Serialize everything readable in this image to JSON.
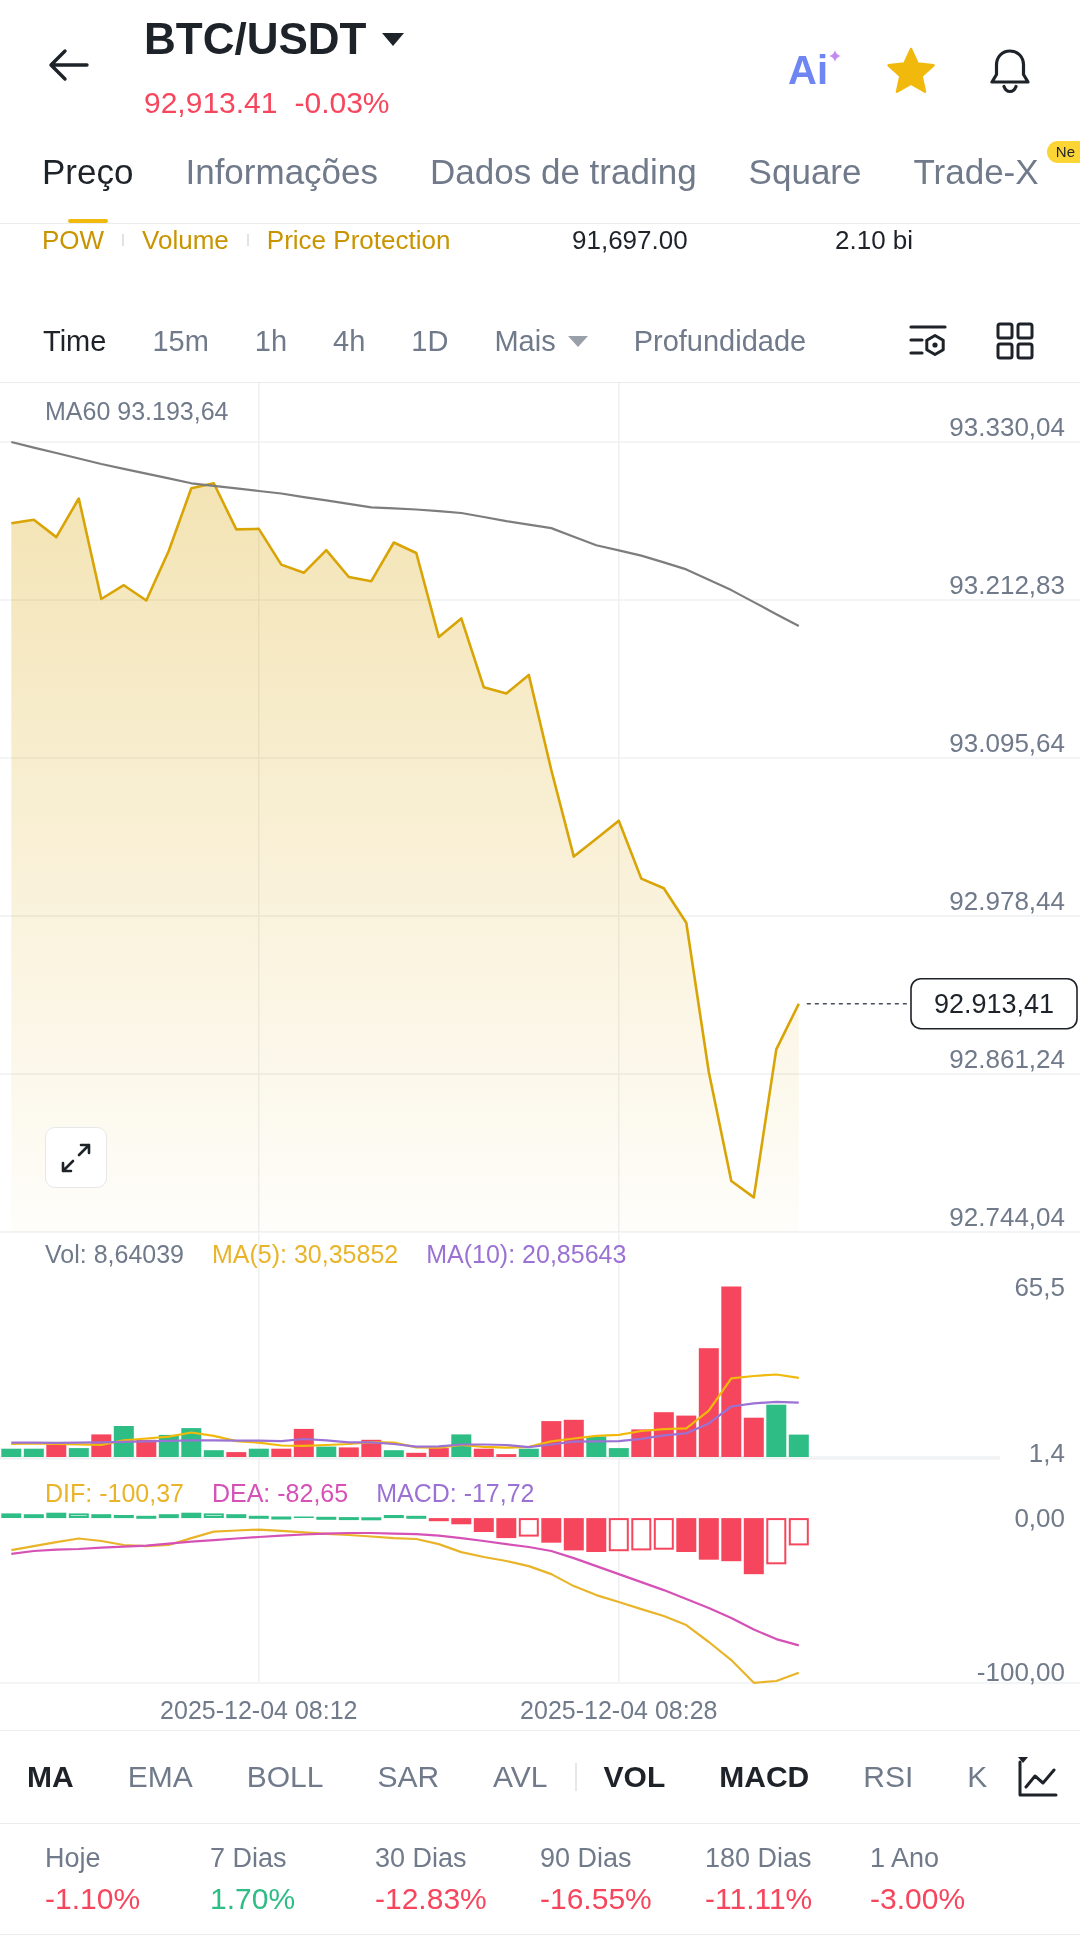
{
  "header": {
    "title": "BTC/USDT",
    "price": "92,913.41",
    "change": "-0.03%",
    "rising": false,
    "ai_label": "Ai",
    "favorite": true
  },
  "tabs": [
    {
      "label": "Preço",
      "selected": true
    },
    {
      "label": "Informações",
      "selected": false
    },
    {
      "label": "Dados de trading",
      "selected": false
    },
    {
      "label": "Square",
      "selected": false
    },
    {
      "label": "Trade-X",
      "selected": false,
      "badge": "Ne"
    }
  ],
  "info_row": {
    "tags": [
      "POW",
      "Volume",
      "Price Protection"
    ],
    "column_2": "91,697.00",
    "column_3": "2.10 bi"
  },
  "intervals": [
    {
      "label": "Time",
      "kind": "option",
      "selected": true
    },
    {
      "label": "15m",
      "kind": "option",
      "selected": false
    },
    {
      "label": "1h",
      "kind": "option",
      "selected": false
    },
    {
      "label": "4h",
      "kind": "option",
      "selected": false
    },
    {
      "label": "1D",
      "kind": "option",
      "selected": false
    },
    {
      "label": "Mais",
      "kind": "dropdown",
      "selected": false
    },
    {
      "label": "Profundidade",
      "kind": "option",
      "selected": false
    }
  ],
  "price_chart": {
    "legend": "MA60 93.193,64",
    "current_price": "92.913,41",
    "chart_data": {
      "type": "area",
      "categories": [
        null,
        null,
        null,
        null,
        null,
        null,
        null,
        null,
        null,
        null,
        null,
        null,
        null,
        null,
        null,
        null,
        null,
        null,
        null,
        null,
        null,
        null,
        null,
        null,
        null,
        null,
        null,
        null,
        null,
        null,
        null,
        null,
        null,
        null,
        null,
        null,
        null,
        null,
        null,
        null,
        null,
        null,
        null,
        null,
        null,
        null,
        null,
        null
      ],
      "series": [
        {
          "type": "area",
          "color": "#d9a406",
          "values": [
            93269.7,
            93272.3,
            93259.5,
            93288.1,
            93213.6,
            93223.8,
            93212.5,
            93249.3,
            93295.8,
            93299.4,
            93265.2,
            93265.6,
            93239.1,
            93233.0,
            93249.8,
            93229.9,
            93226.8,
            93255.5,
            93247.7,
            93185.4,
            93199.2,
            93148.1,
            93143.5,
            93157.3,
            93086.7,
            93022.5,
            93035.8,
            93049.1,
            93006.2,
            92999.0,
            92973.5,
            92862.7,
            92781.9,
            92769.7,
            92879.5,
            92913.4,
            null,
            null,
            null,
            null,
            null,
            null,
            null,
            null,
            null,
            null,
            null,
            null
          ]
        },
        {
          "type": "line",
          "color": "#7d7d7d",
          "values": [
            93330.0,
            93325.9,
            93321.9,
            93317.8,
            93313.7,
            93310.1,
            93306.6,
            93303.0,
            93299.4,
            93297.5,
            93295.6,
            93293.7,
            93291.8,
            93289.2,
            93286.7,
            93284.1,
            93281.5,
            93280.8,
            93280.0,
            93278.7,
            93277.4,
            93274.4,
            93271.3,
            93268.8,
            93266.2,
            93259.8,
            93253.4,
            93249.6,
            93245.8,
            93240.7,
            93235.5,
            93227.9,
            93220.2,
            93211.3,
            93202.3,
            93193.6,
            null,
            null,
            null,
            null,
            null,
            null,
            null,
            null,
            null,
            null,
            null,
            null
          ]
        }
      ],
      "ylim": [
        92744.04,
        93373.8
      ],
      "yticks": [
        {
          "value": 93330.04,
          "label": "93.330,04"
        },
        {
          "value": 93212.83,
          "label": "93.212,83"
        },
        {
          "value": 93095.64,
          "label": "93.095,64"
        },
        {
          "value": 92978.44,
          "label": "92.978,44"
        },
        {
          "value": 92861.24,
          "label": "92.861,24"
        },
        {
          "value": 92744.04,
          "label": "92.744,04"
        }
      ],
      "grid": true
    }
  },
  "volume_chart": {
    "legend": [
      {
        "text": "Vol: 8,64039",
        "color": "#707a8a"
      },
      {
        "text": "MA(5): 30,35852",
        "color": "#e9b42a"
      },
      {
        "text": "MA(10): 20,85643",
        "color": "#9b72d3"
      }
    ],
    "chart_data": {
      "type": "bar",
      "categories": [
        null,
        null,
        null,
        null,
        null,
        null,
        null,
        null,
        null,
        null,
        null,
        null,
        null,
        null,
        null,
        null,
        null,
        null,
        null,
        null,
        null,
        null,
        null,
        null,
        null,
        null,
        null,
        null,
        null,
        null,
        null,
        null,
        null,
        null,
        null,
        null,
        null,
        null,
        null,
        null,
        null,
        null,
        null,
        null,
        null,
        null,
        null,
        null
      ],
      "series": [
        {
          "type": "bar",
          "color": "#2ebd85",
          "values": [
            3.2,
            3.2,
            null,
            3.4,
            null,
            11.9,
            null,
            8.5,
            11.1,
            2.6,
            null,
            3.2,
            null,
            null,
            4.0,
            null,
            null,
            2.6,
            null,
            null,
            8.7,
            null,
            null,
            3.2,
            null,
            null,
            7.9,
            3.4,
            null,
            null,
            null,
            null,
            null,
            null,
            20.1,
            8.6,
            null,
            null,
            null,
            null,
            null,
            null,
            null,
            null,
            null,
            null,
            null,
            null
          ]
        },
        {
          "type": "bar",
          "color": "#f6465d",
          "values": [
            null,
            null,
            4.8,
            null,
            8.7,
            null,
            6.6,
            null,
            null,
            null,
            1.9,
            null,
            3.2,
            10.8,
            null,
            3.7,
            6.6,
            null,
            1.6,
            3.4,
            null,
            3.2,
            1.1,
            null,
            13.8,
            14.3,
            null,
            null,
            10.6,
            17.2,
            15.9,
            41.8,
            65.5,
            15.1,
            null,
            null,
            null,
            null,
            null,
            null,
            null,
            null,
            null,
            null,
            null,
            null,
            null,
            null
          ]
        },
        {
          "type": "line",
          "color": "#f0b90b",
          "values": [
            5.0,
            5.2,
            5.0,
            4.8,
            4.7,
            6.4,
            7.1,
            7.8,
            9.4,
            8.1,
            6.1,
            5.5,
            4.4,
            4.3,
            4.6,
            5.0,
            5.7,
            5.5,
            3.7,
            3.6,
            4.6,
            3.9,
            3.6,
            3.9,
            6.0,
            7.1,
            8.1,
            8.5,
            10.0,
            10.7,
            11.0,
            17.8,
            30.2,
            31.1,
            31.7,
            30.4,
            null,
            null,
            null,
            null,
            null,
            null,
            null,
            null,
            null,
            null,
            null,
            null
          ]
        },
        {
          "type": "line",
          "color": "#9b72d3",
          "values": [
            5.5,
            5.5,
            5.4,
            5.5,
            5.6,
            5.8,
            6.0,
            6.2,
            6.4,
            6.4,
            6.3,
            6.3,
            6.1,
            6.9,
            6.4,
            5.6,
            5.6,
            5.0,
            4.0,
            4.1,
            4.8,
            4.8,
            4.6,
            3.8,
            4.8,
            5.9,
            6.0,
            6.1,
            7.0,
            8.3,
            9.1,
            12.9,
            19.4,
            20.6,
            21.2,
            20.9,
            null,
            null,
            null,
            null,
            null,
            null,
            null,
            null,
            null,
            null,
            null,
            null
          ]
        }
      ],
      "ylim": [
        0,
        65.5
      ],
      "yticks": [
        {
          "value": 65.5,
          "label": "65,5"
        },
        {
          "value": 1.4,
          "label": "1,4"
        }
      ],
      "grid": true
    }
  },
  "macd_chart": {
    "legend": [
      {
        "text": "DIF: -100,37",
        "color": "#e9b42a"
      },
      {
        "text": "DEA: -82,65",
        "color": "#d651b6"
      },
      {
        "text": "MACD: -17,72",
        "color": "#9b72d3"
      }
    ],
    "chart_data": {
      "type": "bar",
      "categories": [
        null,
        null,
        null,
        null,
        null,
        null,
        null,
        null,
        null,
        null,
        null,
        "2025-12-04 08:12",
        null,
        null,
        null,
        null,
        null,
        null,
        null,
        null,
        null,
        null,
        null,
        null,
        null,
        null,
        null,
        "2025-12-04 08:28",
        null,
        null,
        null,
        null,
        null,
        null,
        null,
        null,
        null,
        null,
        null,
        null,
        null,
        null,
        null,
        null,
        null,
        null,
        null,
        null
      ],
      "series": [
        {
          "type": "bar",
          "colors": [
            "#2ebd85",
            "#2ebd85",
            "#2ebd85",
            "#2ebd85",
            "#2ebd85",
            "#2ebd85",
            "#2ebd85",
            "#2ebd85",
            "#2ebd85",
            "#2ebd85",
            "#2ebd85",
            "#2ebd85",
            "#2ebd85",
            "#2ebd85",
            "#2ebd85",
            "#2ebd85",
            "#2ebd85",
            "#2ebd85",
            "#2ebd85",
            "#f6465d",
            "#f6465d",
            "#f6465d",
            "#f6465d",
            "#f6465d",
            "#f6465d",
            "#f6465d",
            "#f6465d",
            "#f6465d",
            "#f6465d",
            "#f6465d",
            "#f6465d",
            "#f6465d",
            "#f6465d",
            "#f6465d",
            "#f6465d",
            "#f6465d",
            null,
            null,
            null,
            null,
            null,
            null,
            null,
            null,
            null,
            null,
            null,
            null
          ],
          "values": [
            3,
            2.5,
            3.5,
            3,
            2.5,
            2,
            1.5,
            2.5,
            3.5,
            3,
            2.5,
            1.5,
            1,
            1,
            0.8,
            0.6,
            0.5,
            2,
            1.5,
            -2,
            -4,
            -9,
            -13,
            -12,
            -16,
            -21,
            -22,
            -21.5,
            -21,
            -20.5,
            -22,
            -27,
            -28,
            -36.4,
            -30,
            -17.7,
            null,
            null,
            null,
            null,
            null,
            null,
            null,
            null,
            null,
            null,
            null,
            null
          ]
        },
        {
          "type": "line",
          "color": "#e9b42a",
          "values": [
            -20.8,
            -18.2,
            -15.6,
            -13.3,
            -14.9,
            -17.5,
            -18.2,
            -17.5,
            -13.0,
            -8.8,
            -8.1,
            -7.5,
            -8.3,
            -9.3,
            -10.2,
            -11.0,
            -12.0,
            -13.0,
            -13.6,
            -16.9,
            -22.1,
            -25.3,
            -27.9,
            -31.2,
            -36.4,
            -44.2,
            -50.0,
            -54.5,
            -59.1,
            -63.6,
            -69.5,
            -80.5,
            -92.2,
            -107.0,
            -105.8,
            -100.4,
            null,
            null,
            null,
            null,
            null,
            null,
            null,
            null,
            null,
            null,
            null,
            null
          ]
        },
        {
          "type": "line",
          "color": "#d651b6",
          "values": [
            -23.2,
            -21.4,
            -20.5,
            -20.1,
            -19.2,
            -18.5,
            -17.9,
            -16.6,
            -15.3,
            -14.3,
            -13.3,
            -12.3,
            -11.4,
            -10.7,
            -10.1,
            -9.7,
            -9.7,
            -10.1,
            -10.4,
            -11.4,
            -13.0,
            -14.9,
            -16.9,
            -18.8,
            -21.4,
            -26.0,
            -31.2,
            -36.4,
            -41.6,
            -46.8,
            -52.6,
            -58.4,
            -64.9,
            -72.4,
            -78.6,
            -82.7,
            null,
            null,
            null,
            null,
            null,
            null,
            null,
            null,
            null,
            null,
            null,
            null
          ]
        }
      ],
      "ylim": [
        -107.1,
        39
      ],
      "yticks": [
        {
          "value": 0,
          "label": "0,00"
        },
        {
          "value": -100,
          "label": "-100,00"
        }
      ],
      "grid": true
    }
  },
  "indicators": {
    "main": [
      {
        "label": "MA",
        "selected": true
      },
      {
        "label": "EMA",
        "selected": false
      },
      {
        "label": "BOLL",
        "selected": false
      },
      {
        "label": "SAR",
        "selected": false
      },
      {
        "label": "AVL",
        "selected": false
      }
    ],
    "sub": [
      {
        "label": "VOL",
        "selected": true
      },
      {
        "label": "MACD",
        "selected": true
      },
      {
        "label": "RSI",
        "selected": false
      },
      {
        "label": "K",
        "selected": false
      }
    ]
  },
  "performance": [
    {
      "label": "Hoje",
      "value": "-1.10%",
      "color": "#f6465d"
    },
    {
      "label": "7 Dias",
      "value": "1.70%",
      "color": "#2ebd85"
    },
    {
      "label": "30 Dias",
      "value": "-12.83%",
      "color": "#f6465d"
    },
    {
      "label": "90 Dias",
      "value": "-16.55%",
      "color": "#f6465d"
    },
    {
      "label": "180 Dias",
      "value": "-11.11%",
      "color": "#f6465d"
    },
    {
      "label": "1 Ano",
      "value": "-3.00%",
      "color": "#f6465d"
    }
  ]
}
